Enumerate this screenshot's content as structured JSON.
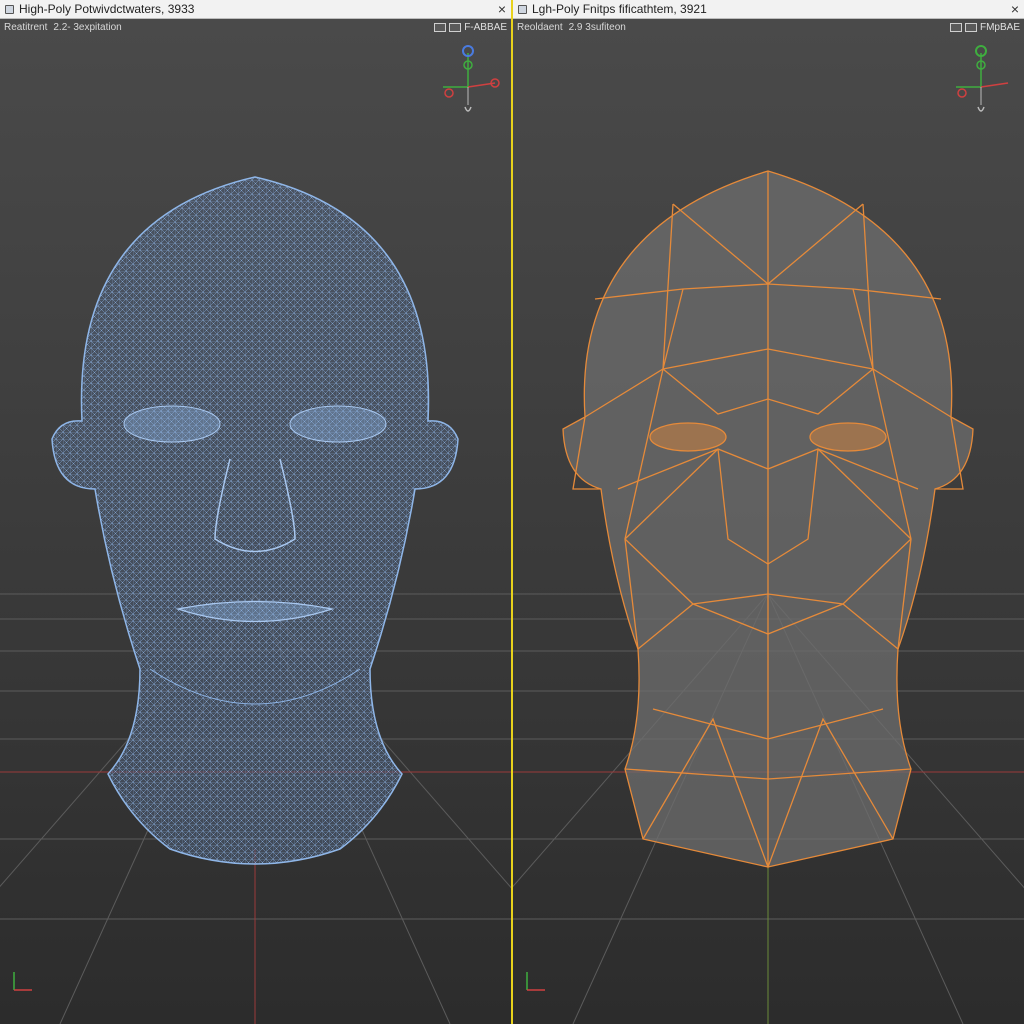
{
  "left_window": {
    "title": "High-Poly Potwivdctwaters, 3933",
    "close_symbol": "×",
    "viewport_label": "Reatitrent",
    "viewport_info": "2.2-  3expitation",
    "mode_text": "F-ABBAE",
    "mesh_color": "#8fb6e8",
    "icon": "window-icon"
  },
  "right_window": {
    "title": "Lgh-Poly Fnitps fificathtem, 3921",
    "close_symbol": "×",
    "viewport_label": "Reoldaent",
    "viewport_info": "2.9  3sufiteon",
    "mode_text": "FMpBAE",
    "mesh_color": "#e58a3a",
    "icon": "window-icon"
  },
  "colors": {
    "divider": "#e8d21c",
    "axis_x": "#d04040",
    "axis_y": "#3fae3f",
    "axis_z": "#4a7be0"
  }
}
